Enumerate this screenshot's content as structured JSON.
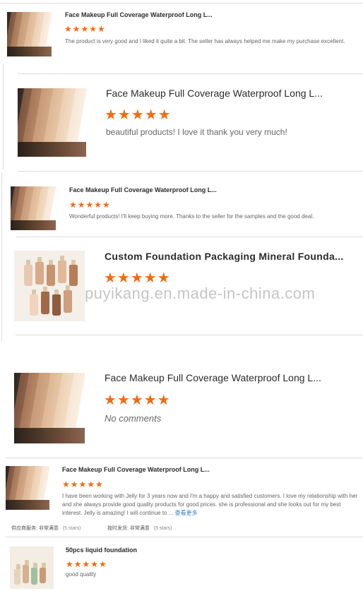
{
  "reviews": [
    {
      "title": "Face Makeup Full Coverage Waterproof Long L...",
      "stars": "★★★★★",
      "comment": "The product is very good and I liked it quite a bit. The seller has always helped me make my purchase excellent."
    },
    {
      "title": "Face Makeup Full Coverage Waterproof Long L...",
      "stars": "★★★★★",
      "comment": "beautiful products! I love it thank you very much!"
    },
    {
      "title": "Face Makeup Full Coverage Waterproof Long L...",
      "stars": "★★★★★",
      "comment": "Wonderful products! I'll keep buying more. Thanks to the seller for the samples and the good deal."
    },
    {
      "title": "Custom Foundation Packaging Mineral Founda...",
      "stars": "★★★★★",
      "comment": ""
    },
    {
      "title": "Face Makeup Full Coverage Waterproof Long L...",
      "stars": "★★★★★",
      "comment": "No comments"
    },
    {
      "title": "Face Makeup Full Coverage Waterproof Long L...",
      "stars": "★★★★★",
      "comment": "I have been working with Jelly for 3 years now and I'm a happy and satisfied customers. I love my relationship with her and she always provide good quality products for good prices. she is professional and she looks out for my best interest. Jelly is amazing! I will continue to ...",
      "more": "查看更多",
      "meta": [
        {
          "label": "供应商服务: 非常满意",
          "note": "(5 stars)"
        },
        {
          "label": "按时发货: 非常满意",
          "note": "(5 stars)"
        }
      ]
    },
    {
      "title": "50pcs liquid foundation",
      "stars": "★★★★★",
      "comment": "good quality"
    }
  ],
  "watermark": "puyikang.en.made-in-china.com",
  "icons": {
    "star": "star-icon"
  },
  "colors": {
    "star": "#f26b10",
    "link": "#2a7ad8"
  }
}
